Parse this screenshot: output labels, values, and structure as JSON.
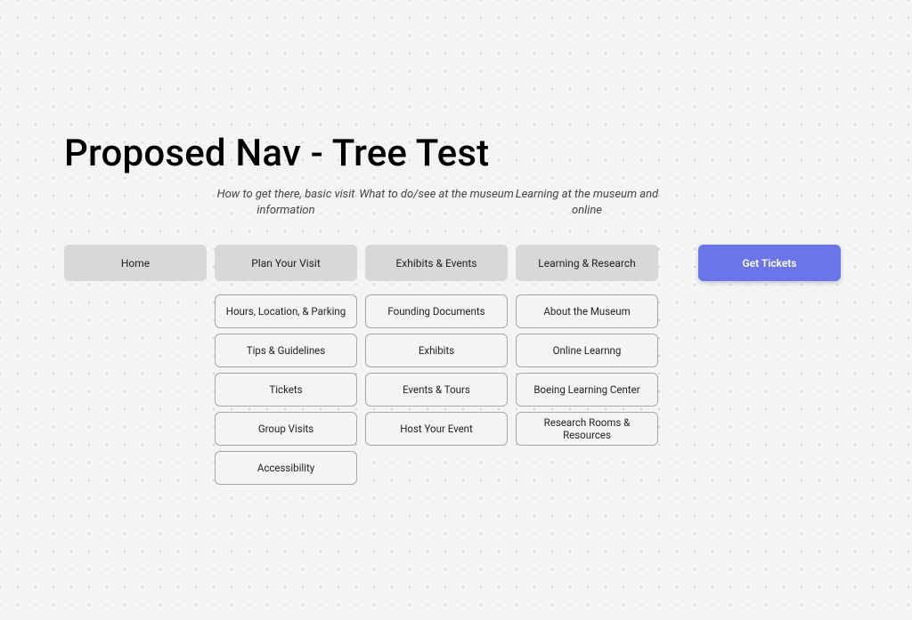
{
  "page_title": "Proposed Nav - Tree Test",
  "descriptions": {
    "col2": "How to get there, basic visit information",
    "col3": "What to do/see at the museum",
    "col4": "Learning at the museum and online"
  },
  "nav": {
    "col1": {
      "label": "Home",
      "items": []
    },
    "col2": {
      "label": "Plan Your Visit",
      "items": [
        "Hours, Location, & Parking",
        "Tips & Guidelines",
        "Tickets",
        "Group Visits",
        "Accessibility"
      ]
    },
    "col3": {
      "label": "Exhibits & Events",
      "items": [
        "Founding Documents",
        "Exhibits",
        "Events & Tours",
        "Host Your Event"
      ]
    },
    "col4": {
      "label": "Learning & Research",
      "items": [
        "About the Museum",
        "Online Learnng",
        "Boeing Learning Center",
        "Research Rooms & Resources"
      ]
    }
  },
  "cta": {
    "label": "Get Tickets"
  },
  "colors": {
    "cta_bg": "#6c74ea",
    "top_bg": "#d8d8d8"
  }
}
